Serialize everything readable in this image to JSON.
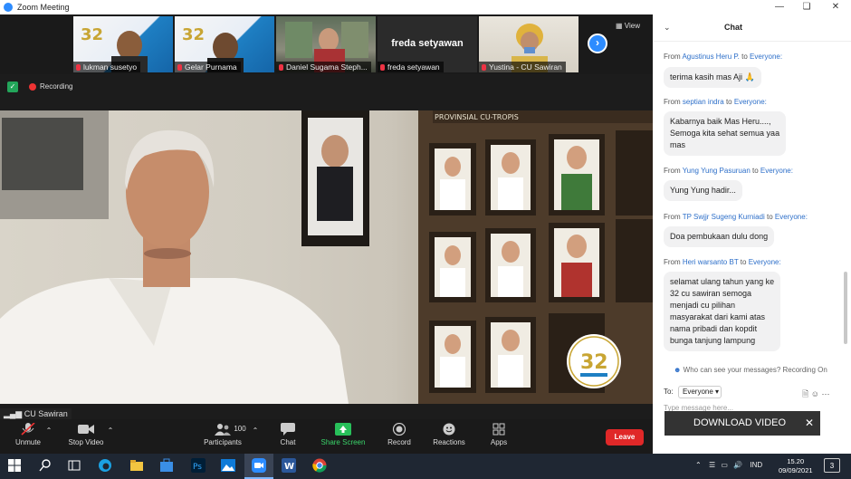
{
  "window": {
    "title": "Zoom Meeting"
  },
  "thumbs": [
    {
      "name": "lukman susetyo"
    },
    {
      "name": "Gelar Purnama"
    },
    {
      "name": "Daniel Sugama Steph..."
    },
    {
      "name": "freda setyawan",
      "big_name": "freda setyawan"
    },
    {
      "name": "Yustina - CU Sawiran"
    }
  ],
  "view_label": "View",
  "recording_label": "Recording",
  "video": {
    "participant": "CU Sawiran",
    "logo_text": "32"
  },
  "toolbar": {
    "unmute": "Unmute",
    "stop_video": "Stop Video",
    "participants": "Participants",
    "participants_count": "100",
    "chat": "Chat",
    "share_screen": "Share Screen",
    "record": "Record",
    "reactions": "Reactions",
    "apps": "Apps",
    "leave": "Leave"
  },
  "chat": {
    "title": "Chat",
    "messages": [
      {
        "from": "From",
        "sender": "Agustinus Heru P.",
        "to": "to",
        "recipient": "Everyone:",
        "text": "terima kasih mas Aji 🙏"
      },
      {
        "from": "From",
        "sender": "septian indra",
        "to": "to",
        "recipient": "Everyone:",
        "lines": [
          "Kabarnya baik Mas Heru....,",
          "Semoga kita sehat semua yaa",
          "mas"
        ]
      },
      {
        "from": "From",
        "sender": "Yung Yung Pasuruan",
        "to": "to",
        "recipient": "Everyone:",
        "text": "Yung Yung hadir..."
      },
      {
        "from": "From",
        "sender": "TP Swjjr Sugeng Kurniadi",
        "to": "to",
        "recipient": "Everyone:",
        "text": "Doa pembukaan dulu dong"
      },
      {
        "from": "From",
        "sender": "Heri warsanto BT",
        "to": "to",
        "recipient": "Everyone:",
        "lines": [
          "selamat ulang tahun yang ke",
          "32 cu sawiran semoga",
          "menjadi cu pilihan",
          "masyarakat dari kami atas",
          "nama pribadi dan kopdit",
          "bunga tanjung lampung"
        ]
      }
    ],
    "privacy_note": "Who can see your messages? Recording On",
    "to_label": "To:",
    "to_value": "Everyone",
    "input_placeholder": "Type message here...",
    "download_label": "DOWNLOAD VIDEO"
  },
  "taskbar": {
    "lang": "IND",
    "time": "15.20",
    "date": "09/09/2021",
    "notifications": "3"
  }
}
